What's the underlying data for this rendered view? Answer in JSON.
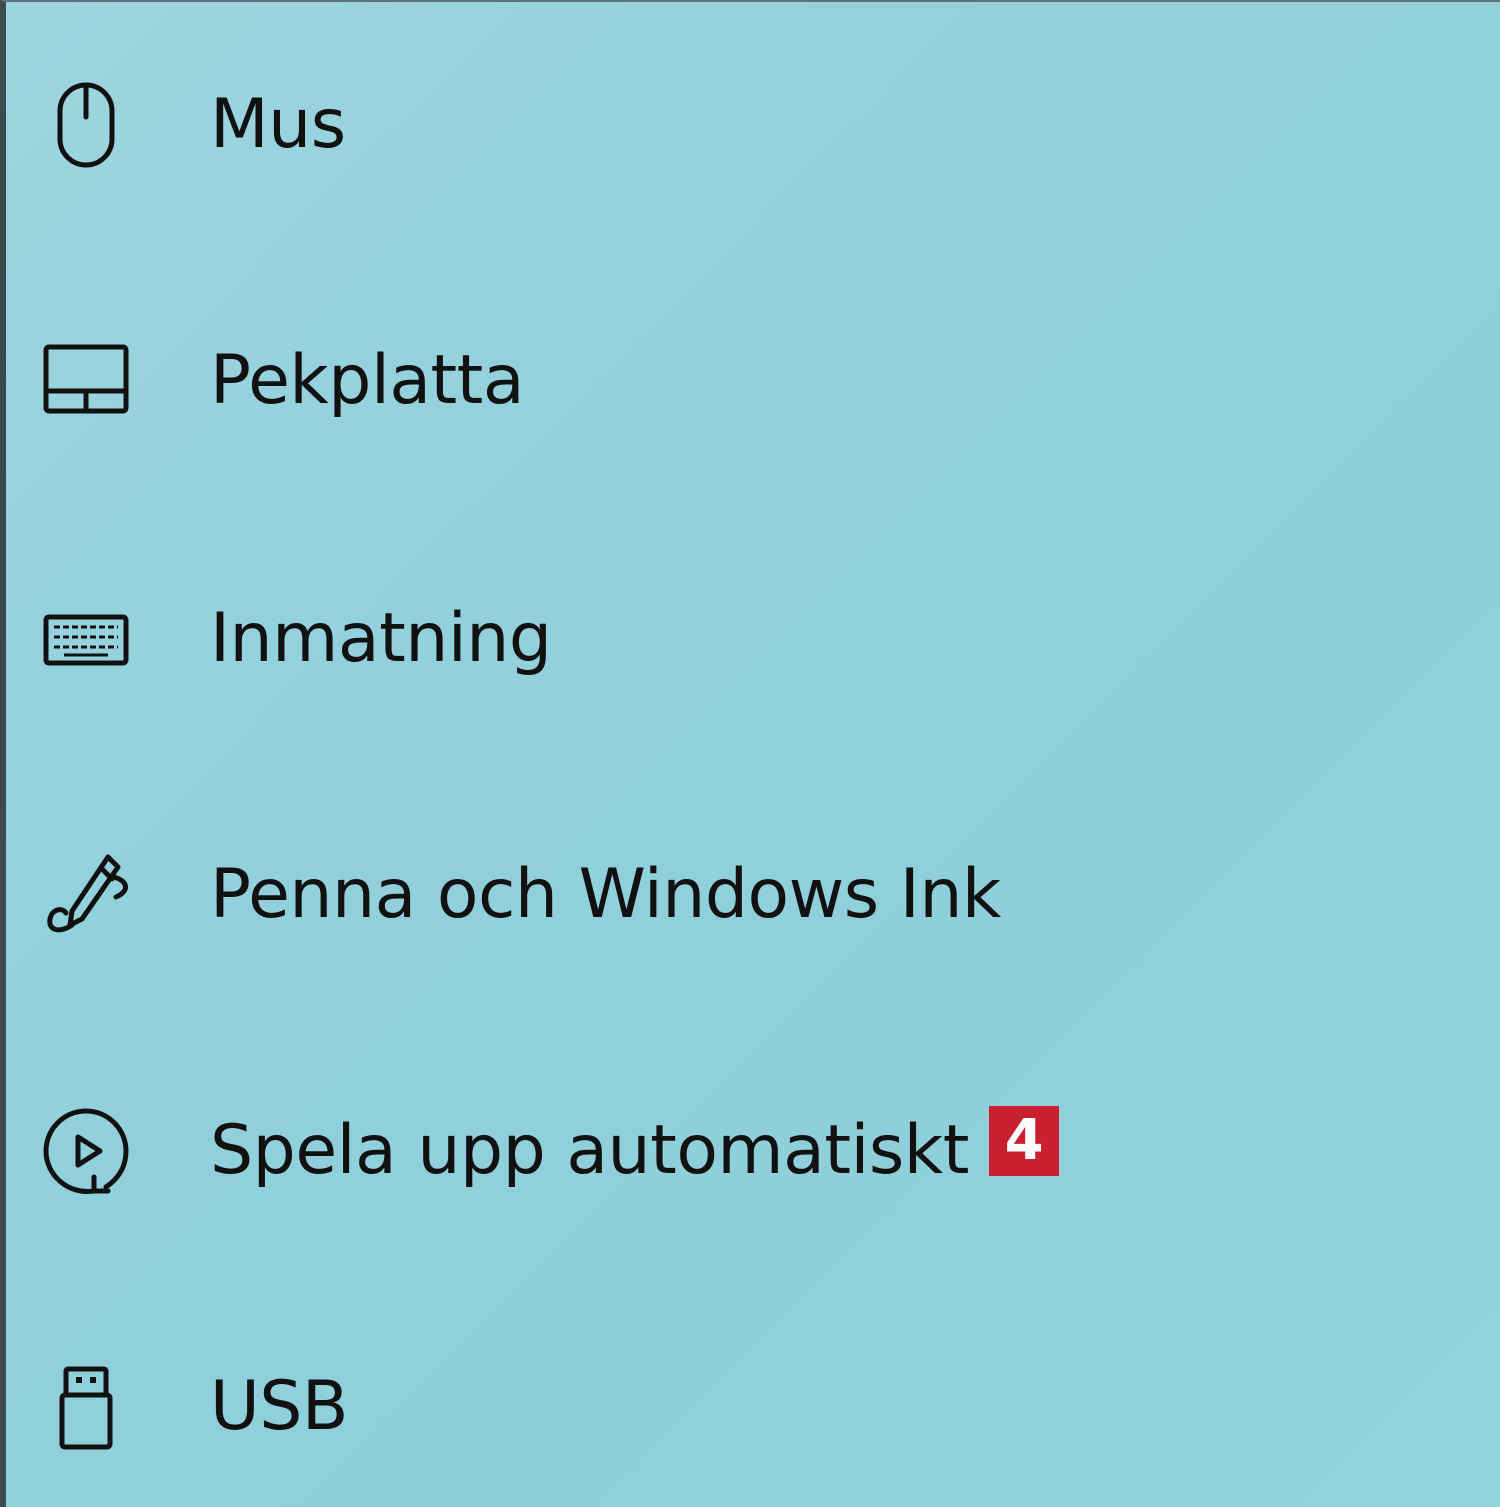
{
  "colors": {
    "background": "#93d1dc",
    "text": "#111111",
    "badge_background": "#c8202e",
    "badge_text": "#ffffff"
  },
  "nav": {
    "items": [
      {
        "label": "Mus",
        "icon": "mouse-icon"
      },
      {
        "label": "Pekplatta",
        "icon": "touchpad-icon"
      },
      {
        "label": "Inmatning",
        "icon": "keyboard-icon"
      },
      {
        "label": "Penna och Windows Ink",
        "icon": "pen-icon"
      },
      {
        "label": "Spela upp automatiskt",
        "icon": "autoplay-icon",
        "badge": "4"
      },
      {
        "label": "USB",
        "icon": "usb-icon"
      }
    ]
  }
}
